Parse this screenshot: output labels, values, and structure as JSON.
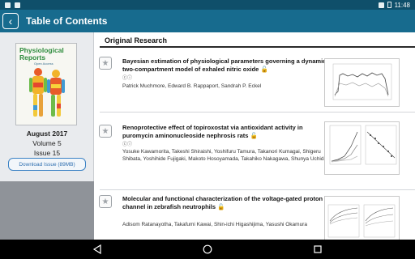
{
  "status_bar": {
    "time": "11:48"
  },
  "app_bar": {
    "title": "Table of Contents",
    "back_icon": "‹"
  },
  "sidebar": {
    "cover": {
      "title_line1": "Physiological",
      "title_line2": "Reports",
      "subtitle": "Open Access"
    },
    "issue_date": "August 2017",
    "volume": "Volume 5",
    "issue": "Issue 15",
    "download_label": "Download Issue (89MB)"
  },
  "main": {
    "section_heading": "Original Research",
    "articles": [
      {
        "title": "Bayesian estimation of physiological parameters governing a dynamic two-compartment model of exhaled nitric oxide",
        "badges": "ⓒⓘ",
        "authors": "Patrick Muchmore, Edward B. Rappaport, Sandrah P. Eckel"
      },
      {
        "title": "Renoprotective effect of topiroxostat via antioxidant activity in puromycin aminonucleoside nephrosis rats",
        "badges": "ⓒⓘ",
        "authors": "Yosuke Kawamorita, Takeshi Shiraishi, Yoshifuru Tamura, Takanori Kumagai, Shigeru Shibata, Yoshihide Fujigaki, Makoto Hosoyamada, Takahiko Nakagawa, Shunya Uchida"
      },
      {
        "title": "Molecular and functional characterization of the voltage-gated proton channel in zebrafish neutrophils",
        "badges": "",
        "authors": "Adisom Ratanayotha, Takafumi Kawai, Shin-ichi Higashijima, Yasushi Okamura"
      }
    ]
  },
  "icons": {
    "star": "★",
    "open_access": "🔓"
  },
  "colors": {
    "app_bar": "#176b8e",
    "status_bar": "#0f4f6a",
    "accent": "#2f6fb0"
  }
}
